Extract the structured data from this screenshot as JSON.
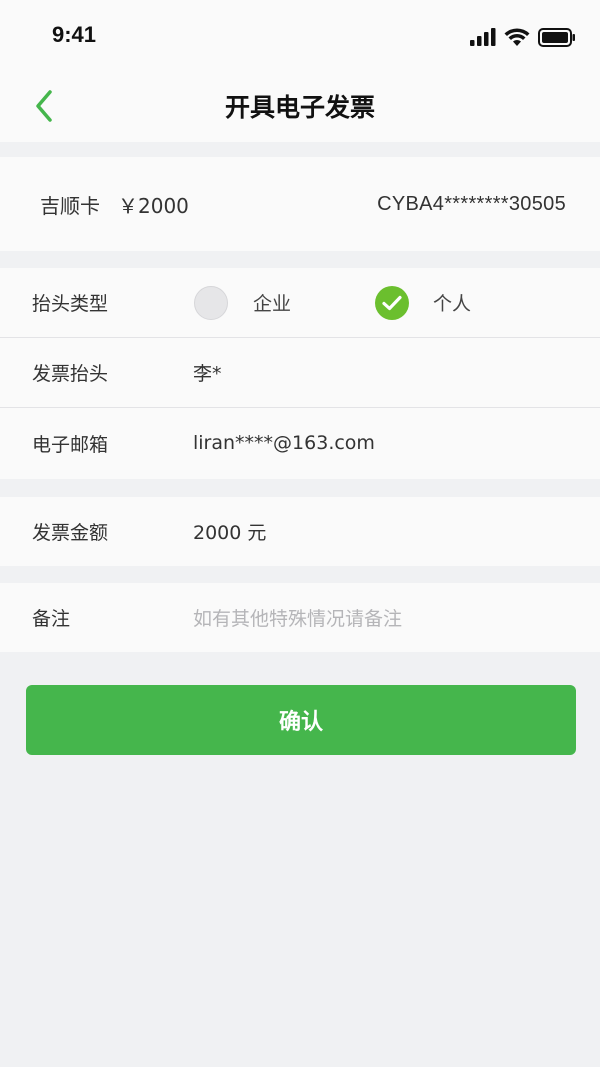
{
  "status_bar": {
    "time": "9:41",
    "icons": [
      "signal-icon",
      "wifi-icon",
      "battery-icon"
    ]
  },
  "header": {
    "title": "开具电子发票",
    "back_icon": "chevron-left-icon"
  },
  "gift_card": {
    "name": "吉顺卡",
    "amount": "￥2000",
    "number": "CYBA4********30505"
  },
  "invoice_form": {
    "title_type": {
      "label": "抬头类型",
      "options": [
        {
          "label": "企业",
          "selected": false
        },
        {
          "label": "个人",
          "selected": true
        }
      ]
    },
    "invoice_title": {
      "label": "发票抬头",
      "value": "李*"
    },
    "email": {
      "label": "电子邮箱",
      "value": "liran****@163.com"
    }
  },
  "amount_section": {
    "label": "发票金额",
    "value": "2000 元"
  },
  "remarks": {
    "label": "备注",
    "placeholder": "如有其他特殊情况请备注"
  },
  "confirm_button": {
    "label": "确认"
  },
  "colors": {
    "accent_green": "#45b64c",
    "check_green": "#6bbf2e",
    "page_background": "#f0f1f3"
  }
}
